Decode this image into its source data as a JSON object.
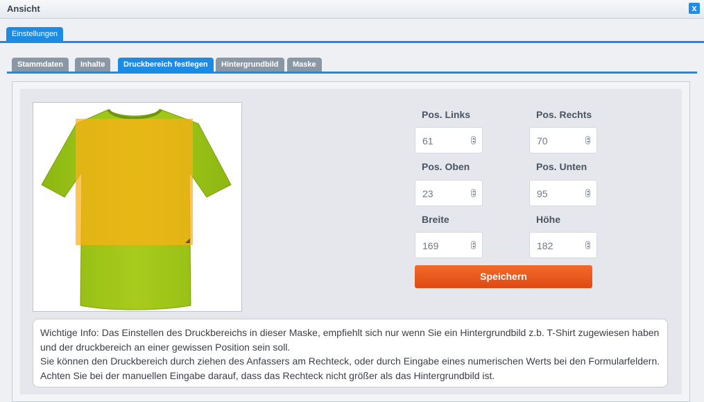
{
  "window": {
    "title": "Ansicht",
    "close_glyph": "x"
  },
  "outer_tabs": [
    {
      "label": "Einstellungen"
    }
  ],
  "inner_tabs": [
    {
      "label": "Stammdaten"
    },
    {
      "label": "Inhalte"
    },
    {
      "label": "Druckbereich festlegen"
    },
    {
      "label": "Hintergrundbild"
    },
    {
      "label": "Maske"
    }
  ],
  "active_inner_tab": "Druckbereich festlegen",
  "form": {
    "pos_links": {
      "label": "Pos. Links",
      "value": "61"
    },
    "pos_rechts": {
      "label": "Pos. Rechts",
      "value": "70"
    },
    "pos_oben": {
      "label": "Pos. Oben",
      "value": "23"
    },
    "pos_unten": {
      "label": "Pos. Unten",
      "value": "95"
    },
    "breite": {
      "label": "Breite",
      "value": "169"
    },
    "hoehe": {
      "label": "Höhe",
      "value": "182"
    },
    "save_label": "Speichern"
  },
  "info": {
    "line1": "Wichtige Info: Das Einstellen des Druckbereichs in dieser Maske, empfiehlt sich nur wenn Sie ein Hintergrundbild z.b. T-Shirt zugewiesen haben und der druckbereich an einer gewissen Position sein soll.",
    "line2": "Sie können den Druckbereich durch ziehen des Anfassers am Rechteck, oder durch Eingabe eines numerischen Werts bei den Formularfeldern. Achten Sie bei der manuellen Eingabe darauf, dass das Rechteck nicht größer als das Hintergrundbild ist."
  },
  "colors": {
    "accent": "#1b8be3",
    "shirt": "#9cc41a",
    "print_area": "#ffb014",
    "save_button": "#e8561c"
  }
}
